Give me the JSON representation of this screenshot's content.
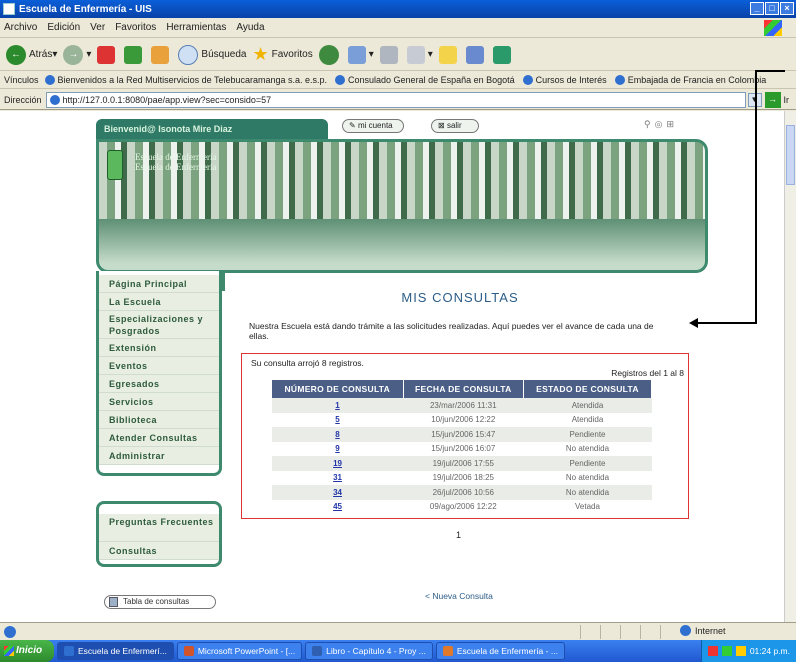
{
  "window": {
    "title": "Escuela de Enfermería - UIS"
  },
  "menu": [
    "Archivo",
    "Edición",
    "Ver",
    "Favoritos",
    "Herramientas",
    "Ayuda"
  ],
  "toolbar": {
    "back": "Atrás",
    "search": "Búsqueda",
    "favorites": "Favoritos"
  },
  "links": {
    "label": "Vínculos",
    "items": [
      "Bienvenidos a la Red Multiservicios de Telebucaramanga s.a. e.s.p.",
      "Consulado General de España en Bogotá",
      "Cursos de Interés",
      "Embajada de Francia en Colombia"
    ]
  },
  "address": {
    "label": "Dirección",
    "url": "http://127.0.0.1:8080/pae/app.view?sec=consido=57",
    "go": "Ir"
  },
  "site": {
    "welcome": "Bienvenid@ Isonota Mire Diaz",
    "mi_cuenta": "mi cuenta",
    "salir": "salir",
    "logo_line1": "Escuela de Enfermería",
    "logo_line2": "Escuela de Enfermería"
  },
  "nav": {
    "items": [
      "Página Principal",
      "La Escuela",
      "Especializaciones y Posgrados",
      "Extensión",
      "Eventos",
      "Egresados",
      "Servicios",
      "Biblioteca",
      "Atender Consultas",
      "Administrar"
    ],
    "secondary": [
      "Preguntas Frecuentes",
      "Consultas"
    ],
    "tabla": "Tabla de consultas"
  },
  "main": {
    "title": "MIS CONSULTAS",
    "intro": "Nuestra Escuela está dando trámite a las solicitudes realizadas. Aquí puedes ver el avance de cada una de ellas.",
    "count_text": "Su consulta arrojó 8 registros.",
    "range_text": "Registros del 1 al 8",
    "columns": [
      "NÚMERO DE CONSULTA",
      "FECHA DE CONSULTA",
      "ESTADO DE CONSULTA"
    ],
    "rows": [
      {
        "num": "1",
        "fecha": "23/mar/2006 11:31",
        "estado": "Atendida"
      },
      {
        "num": "5",
        "fecha": "10/jun/2006 12:22",
        "estado": "Atendida"
      },
      {
        "num": "8",
        "fecha": "15/jun/2006 15:47",
        "estado": "Pendiente"
      },
      {
        "num": "9",
        "fecha": "15/jun/2006 16:07",
        "estado": "No atendida"
      },
      {
        "num": "19",
        "fecha": "19/jul/2006 17:55",
        "estado": "Pendiente"
      },
      {
        "num": "31",
        "fecha": "19/jul/2006 18:25",
        "estado": "No atendida"
      },
      {
        "num": "34",
        "fecha": "26/jul/2006 10:56",
        "estado": "No atendida"
      },
      {
        "num": "45",
        "fecha": "09/ago/2006 12:22",
        "estado": "Vetada"
      }
    ],
    "page": "1",
    "nueva": "< Nueva Consulta"
  },
  "status": {
    "zone": "Internet"
  },
  "taskbar": {
    "start": "Inicio",
    "tasks": [
      "Escuela de Enfermerí...",
      "Microsoft PowerPoint - [...",
      "Libro - Capítulo 4 - Proy ...",
      "Escuela de Enfermería - ..."
    ],
    "clock": "01:24 p.m."
  }
}
